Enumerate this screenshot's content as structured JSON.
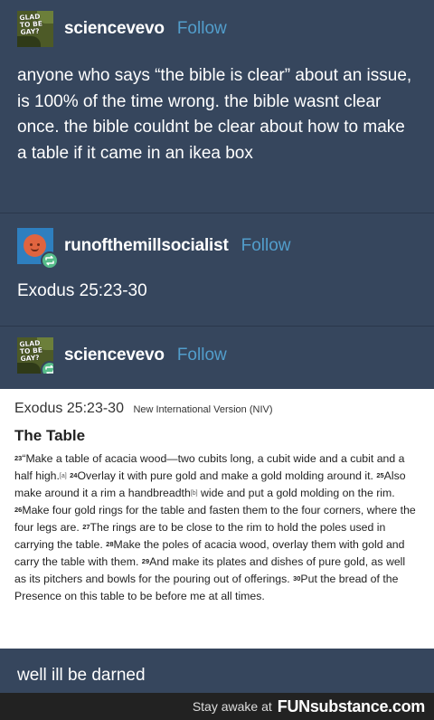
{
  "posts": [
    {
      "author": "sciencevevo",
      "follow": "Follow",
      "avatar_text": "GLAD TO BE GAY?",
      "text": "anyone who says “the bible is clear” about an issue, is 100% of the time wrong. the bible wasnt clear once. the bible couldnt be clear about how to make a table if it came in an ikea box"
    },
    {
      "author": "runofthemillsocialist",
      "follow": "Follow",
      "text": "Exodus 25:23-30"
    },
    {
      "author": "sciencevevo",
      "follow": "Follow",
      "avatar_text": "GLAD TO BE GAY?",
      "passage": {
        "reference": "Exodus 25:23-30",
        "version": "New International Version (NIV)",
        "heading": "The Table",
        "verses": [
          {
            "num": "23",
            "text": "“Make a table of acacia wood—two cubits long, a cubit wide and a cubit and a half high.",
            "note": "[a]"
          },
          {
            "num": "24",
            "text": "Overlay it with pure gold and make a gold molding around it."
          },
          {
            "num": "25",
            "text": "Also make around it a rim a handbreadth",
            "note": "[b]",
            "after": " wide and put a gold molding on the rim."
          },
          {
            "num": "26",
            "text": "Make four gold rings for the table and fasten them to the four corners, where the four legs are."
          },
          {
            "num": "27",
            "text": "The rings are to be close to the rim to hold the poles used in carrying the table."
          },
          {
            "num": "28",
            "text": "Make the poles of acacia wood, overlay them with gold and carry the table with them."
          },
          {
            "num": "29",
            "text": "And make its plates and dishes of pure gold, as well as its pitchers and bowls for the pouring out of offerings."
          },
          {
            "num": "30",
            "text": "Put the bread of the Presence on this table to be before me at all times."
          }
        ]
      },
      "text": "well ill be darned"
    }
  ],
  "watermark": {
    "prefix": "Stay awake at",
    "brand_fun": "FUN",
    "brand_rest": "substance.com"
  },
  "colors": {
    "background": "#36465d",
    "follow": "#529ecc",
    "reblog_badge": "#56bc8a",
    "watermark_bg": "#222222"
  }
}
